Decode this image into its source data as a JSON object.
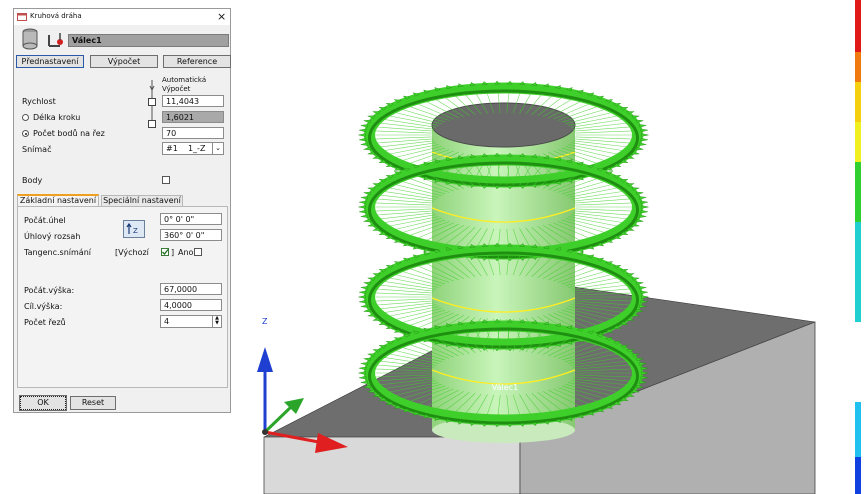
{
  "dialog": {
    "title": "Kruhová dráha",
    "object_name": "Válec1",
    "buttons": {
      "preset": "Přednastavení",
      "calculate": "Výpočet",
      "reference": "Reference"
    },
    "auto_calc_header": "Automatická\nVýpočet",
    "speed_label": "Rychlost",
    "speed_value": "11,4043",
    "step_length_label": "Délka kroku",
    "step_length_value": "1,6021",
    "points_per_cut_label": "Počet bodů na řez",
    "points_per_cut_value": "70",
    "probe_label": "Snímač",
    "probe_value": "#1    1_-Z",
    "points_label": "Body",
    "tabs": [
      "Základní nastavení",
      "Speciální nastavení"
    ],
    "start_angle_label": "Počát.úhel",
    "start_angle_value": "0° 0' 0\"",
    "angle_range_label": "Úhlový rozsah",
    "angle_range_value": "360° 0' 0\"",
    "tangent_label": "Tangenc.snímání",
    "tangent_default_label": "[Výchozí",
    "tangent_default_close": "]",
    "tangent_yes_label": "Ano",
    "start_height_label": "Počát.výška:",
    "start_height_value": "67,0000",
    "target_height_label": "Cíl.výška:",
    "target_height_value": "4,0000",
    "cut_count_label": "Počet řezů",
    "cut_count_value": "4",
    "ok_label": "OK",
    "reset_label": "Reset"
  },
  "viewport": {
    "axis_z_label": "Z",
    "cylinder_label": "Válec1"
  },
  "colors": {
    "ring_green": "#3fcf2a",
    "cylinder": "#b6f0a6",
    "axis_x": "#e02020",
    "axis_y": "#2aa52a",
    "axis_z": "#1f3fd0"
  },
  "icons": [
    "close-icon",
    "window-icon",
    "cylinder-icon",
    "probe-icon",
    "orientation-icon",
    "dropdown-arrow-icon",
    "spinner-icon"
  ]
}
